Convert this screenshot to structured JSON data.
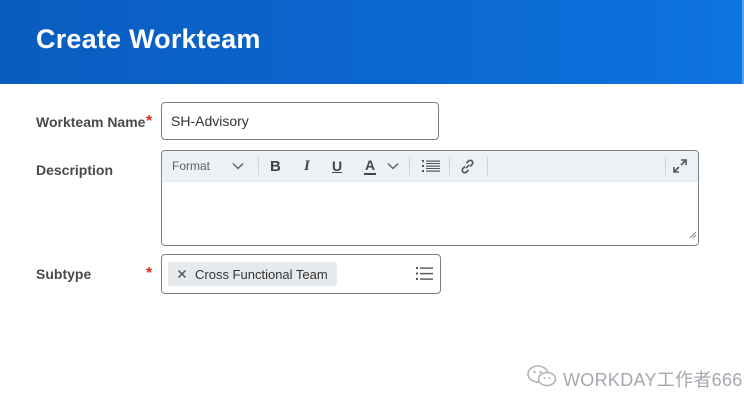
{
  "header": {
    "title": "Create Workteam"
  },
  "form": {
    "workteam_name": {
      "label": "Workteam Name",
      "required_mark": "*",
      "value": "SH-Advisory"
    },
    "description": {
      "label": "Description",
      "toolbar": {
        "format_label": "Format",
        "bold": "B",
        "italic": "I",
        "underline": "U",
        "font_color": "A",
        "icons": [
          "chevron-down-icon",
          "bullet-list-icon",
          "link-icon",
          "expand-icon"
        ]
      },
      "value": ""
    },
    "subtype": {
      "label": "Subtype",
      "required_mark": "*",
      "selected": [
        "Cross Functional Team"
      ],
      "icons": [
        "remove-x-icon",
        "prompt-list-icon"
      ]
    }
  },
  "watermark": {
    "text": "WORKDAY工作者666"
  },
  "colors": {
    "header_start": "#0a5cbf",
    "header_end": "#0d74e0",
    "required": "#de2e21",
    "label": "#4a4a4a",
    "input_border": "#7b8087",
    "toolbar_bg": "#eef1f3",
    "pill_bg": "#e7eaed"
  }
}
